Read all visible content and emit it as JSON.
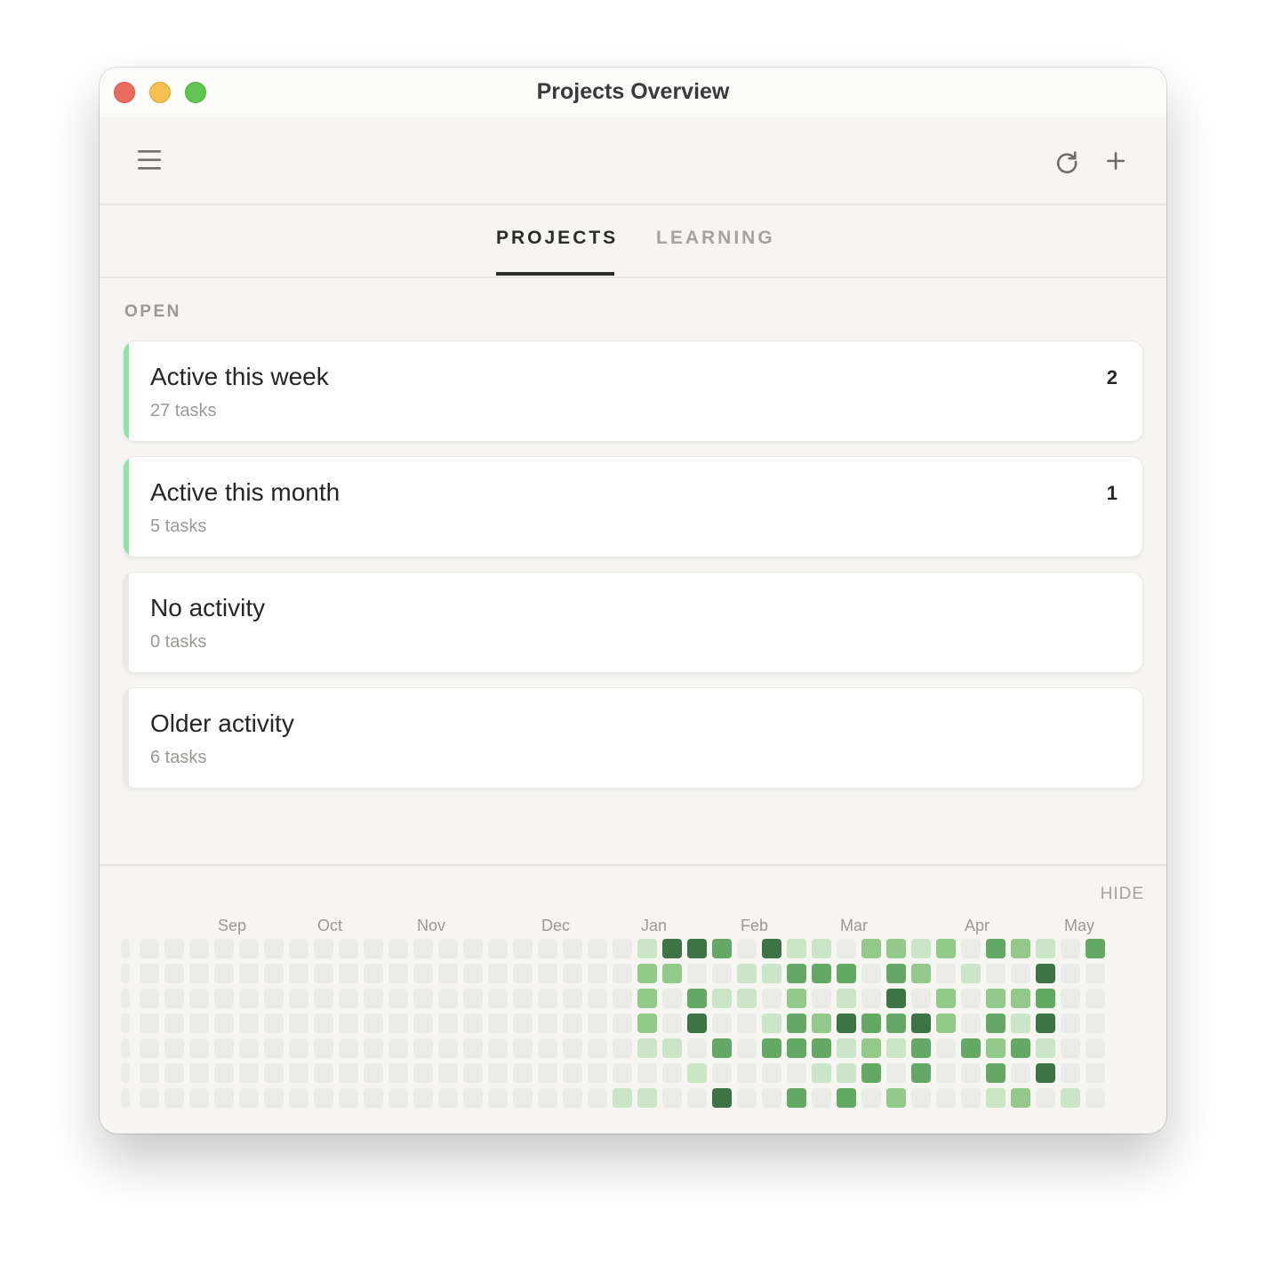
{
  "window": {
    "title": "Projects Overview"
  },
  "toolbar": {
    "menu_icon": "hamburger-menu-icon",
    "refresh_icon": "refresh-icon",
    "add_icon": "plus-icon"
  },
  "tabs": [
    {
      "label": "PROJECTS",
      "active": true
    },
    {
      "label": "LEARNING",
      "active": false
    }
  ],
  "section": {
    "label": "OPEN"
  },
  "cards": [
    {
      "title": "Active this week",
      "subtitle": "27 tasks",
      "count": "2",
      "accent": "#8ee3a8"
    },
    {
      "title": "Active this month",
      "subtitle": "5 tasks",
      "count": "1",
      "accent": "#8ee3a8"
    },
    {
      "title": "No activity",
      "subtitle": "0 tasks",
      "count": "",
      "accent": "#ebe9e5"
    },
    {
      "title": "Older activity",
      "subtitle": "6 tasks",
      "count": "",
      "accent": "#ebe9e5"
    }
  ],
  "heatmap": {
    "hide_label": "HIDE",
    "months": [
      "Sep",
      "Oct",
      "Nov",
      "Dec",
      "Jan",
      "Feb",
      "Mar",
      "Apr",
      "May"
    ],
    "month_week_index": [
      4,
      8,
      12,
      17,
      21,
      25,
      29,
      34,
      38
    ],
    "colors": [
      "#ebebe8",
      "#cbe5c7",
      "#93c98a",
      "#63a864",
      "#3c7446"
    ],
    "weeks": [
      [
        0,
        0,
        0,
        0,
        0,
        0,
        0
      ],
      [
        0,
        0,
        0,
        0,
        0,
        0,
        0
      ],
      [
        0,
        0,
        0,
        0,
        0,
        0,
        0
      ],
      [
        0,
        0,
        0,
        0,
        0,
        0,
        0
      ],
      [
        0,
        0,
        0,
        0,
        0,
        0,
        0
      ],
      [
        0,
        0,
        0,
        0,
        0,
        0,
        0
      ],
      [
        0,
        0,
        0,
        0,
        0,
        0,
        0
      ],
      [
        0,
        0,
        0,
        0,
        0,
        0,
        0
      ],
      [
        0,
        0,
        0,
        0,
        0,
        0,
        0
      ],
      [
        0,
        0,
        0,
        0,
        0,
        0,
        0
      ],
      [
        0,
        0,
        0,
        0,
        0,
        0,
        0
      ],
      [
        0,
        0,
        0,
        0,
        0,
        0,
        0
      ],
      [
        0,
        0,
        0,
        0,
        0,
        0,
        0
      ],
      [
        0,
        0,
        0,
        0,
        0,
        0,
        0
      ],
      [
        0,
        0,
        0,
        0,
        0,
        0,
        0
      ],
      [
        0,
        0,
        0,
        0,
        0,
        0,
        0
      ],
      [
        0,
        0,
        0,
        0,
        0,
        0,
        0
      ],
      [
        0,
        0,
        0,
        0,
        0,
        0,
        0
      ],
      [
        0,
        0,
        0,
        0,
        0,
        0,
        0
      ],
      [
        0,
        0,
        0,
        0,
        0,
        0,
        0
      ],
      [
        0,
        0,
        0,
        0,
        0,
        0,
        1
      ],
      [
        1,
        2,
        2,
        2,
        1,
        0,
        1
      ],
      [
        4,
        2,
        0,
        0,
        1,
        0,
        0
      ],
      [
        4,
        0,
        3,
        4,
        0,
        1,
        0
      ],
      [
        3,
        0,
        1,
        0,
        3,
        0,
        4
      ],
      [
        0,
        1,
        1,
        0,
        0,
        0,
        0
      ],
      [
        4,
        1,
        0,
        1,
        3,
        0,
        0
      ],
      [
        1,
        3,
        2,
        3,
        3,
        0,
        3
      ],
      [
        1,
        3,
        0,
        2,
        3,
        1,
        0
      ],
      [
        0,
        3,
        1,
        4,
        1,
        1,
        3
      ],
      [
        2,
        0,
        0,
        3,
        2,
        3,
        0
      ],
      [
        2,
        3,
        4,
        3,
        1,
        0,
        2
      ],
      [
        1,
        2,
        0,
        4,
        3,
        3,
        0
      ],
      [
        2,
        0,
        2,
        2,
        0,
        0,
        0
      ],
      [
        0,
        1,
        0,
        0,
        3,
        0,
        0
      ],
      [
        3,
        0,
        2,
        3,
        2,
        3,
        1
      ],
      [
        2,
        0,
        2,
        1,
        3,
        0,
        2
      ],
      [
        1,
        4,
        3,
        4,
        1,
        4,
        0
      ],
      [
        0,
        0,
        0,
        0,
        0,
        0,
        1
      ],
      [
        3,
        0,
        0,
        0,
        0,
        0,
        0
      ]
    ]
  }
}
